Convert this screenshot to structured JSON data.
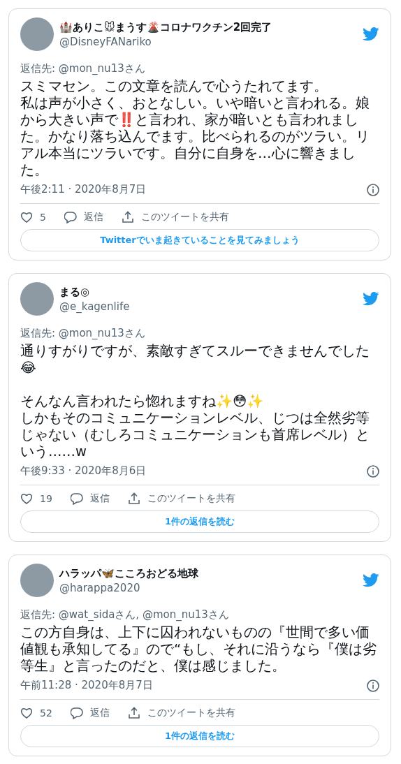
{
  "tweets": [
    {
      "name": "🏰ありこ🐭まうす🌋コロナワクチン2回完了",
      "handle": "@DisneyFANariko",
      "reply_to": "返信先: @mon_nu13さん",
      "paragraphs": [
        [
          "スミマセン。この文章を読んで心うたれてます。",
          "私は声が小さく、おとなしい。いや暗いと言われる。娘から大きい声で‼️と言われ、家が暗いとも言われました。かなり落ち込んでます。比べられるのがツラい。リアル本当にツラいです。自分に自身を…心に響きました。"
        ]
      ],
      "time": "午後2:11 · 2020年8月7日",
      "likes": "5",
      "reply_label": "返信",
      "share_label": "このツイートを共有",
      "button": "Twitterでいま起きていることを見てみましょう"
    },
    {
      "name": "まる◎",
      "handle": "@e_kagenlife",
      "reply_to": "返信先: @mon_nu13さん",
      "paragraphs": [
        [
          "通りすがりですが、素敵すぎてスルーできませんでした😂"
        ],
        [
          "そんなん言われたら惚れますね✨😳✨",
          "しかもそのコミュニケーションレベル、じつは全然劣等じゃない（むしろコミュニケーションも首席レベル）という……w"
        ]
      ],
      "time": "午後9:33 · 2020年8月6日",
      "likes": "19",
      "reply_label": "返信",
      "share_label": "このツイートを共有",
      "button": "1件の返信を読む"
    },
    {
      "name": "ハラッパ🦋こころおどる地球",
      "handle": "@harappa2020",
      "reply_to": "返信先: @wat_sidaさん, @mon_nu13さん",
      "paragraphs": [
        [
          "この方自身は、上下に囚われないものの『世間で多い価値観も承知してる』ので“もし、それに沿うなら『僕は劣等生』と言ったのだと、僕は感じました。"
        ]
      ],
      "time": "午前11:28 · 2020年8月7日",
      "likes": "52",
      "reply_label": "返信",
      "share_label": "このツイートを共有",
      "button": "1件の返信を読む"
    }
  ]
}
